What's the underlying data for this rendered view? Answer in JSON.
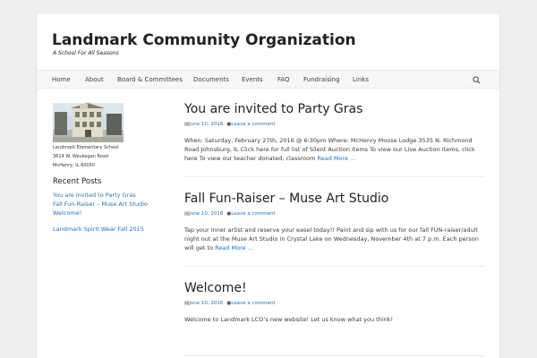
{
  "site": {
    "title": "Landmark Community Organization",
    "tagline": "A School For All Seasons"
  },
  "nav": {
    "items": [
      "Home",
      "About",
      "Board & Committees",
      "Documents",
      "Events",
      "FAQ",
      "Fundraising",
      "Links"
    ],
    "search_icon": "search-icon"
  },
  "sidebar": {
    "address": [
      "Landmark Elementary School",
      "3614 W. Waukegan Road",
      "McHenry, IL 60050"
    ],
    "recent_title": "Recent Posts",
    "recent_posts": [
      "You are invited to Party Gras",
      "Fall Fun-Raiser – Muse Art Studio",
      "Welcome!"
    ],
    "extra_link": "Landmark Spirit Wear Fall 2015"
  },
  "posts": [
    {
      "title": "You are invited to Party Gras",
      "date": "June 10, 2016",
      "comment": "Leave a comment",
      "excerpt": "When: Saturday, February 27th, 2016 @ 6:30pm Where: McHenry Moose Lodge 3535 N. Richmond Road Johnsburg, IL Click here for full list of Silent Auction items To view our Live Auction items, click here To view our teacher donated, classroom",
      "more": "Read More …"
    },
    {
      "title": "Fall Fun-Raiser – Muse Art Studio",
      "date": "June 10, 2016",
      "comment": "Leave a comment",
      "excerpt": "Tap your inner artist and reserve your easel today!! Paint and sip with us for our fall FUN-raiser/adult night out at the Muse Art Studio in Crystal Lake on Wednesday, November 4th at 7 p.m. Each person will get to",
      "more": "Read More …"
    },
    {
      "title": "Welcome!",
      "date": "June 10, 2016",
      "comment": "Leave a comment",
      "excerpt": "Welcome to Landmark LCO’s new website! Let us know what you think!",
      "more": ""
    }
  ],
  "colors": {
    "link": "#1e73be",
    "background": "#efefef",
    "nav": "#f7f7f7"
  }
}
